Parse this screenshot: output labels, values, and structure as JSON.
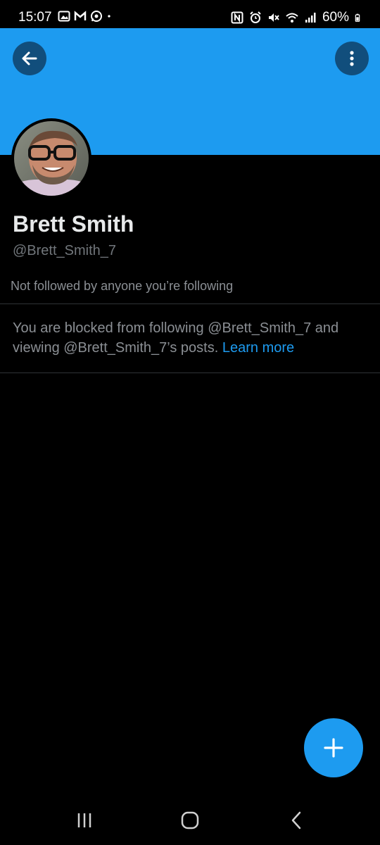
{
  "status_bar": {
    "time": "15:07",
    "battery": "60%",
    "left_icons": [
      "image-icon",
      "gmail-icon",
      "whatsapp-icon",
      "dot-icon"
    ],
    "right_icons": [
      "nfc-icon",
      "alarm-icon",
      "mute-icon",
      "wifi-icon",
      "signal-icon",
      "battery-icon"
    ]
  },
  "header": {
    "back_icon": "arrow-left-icon",
    "more_icon": "more-vertical-icon",
    "banner_color": "#1d9bf0"
  },
  "profile": {
    "name": "Brett Smith",
    "handle": "@Brett_Smith_7",
    "follow_note": "Not followed by anyone you’re following"
  },
  "blocked_notice": {
    "text": "You are blocked from following @Brett_Smith_7 and viewing @Brett_Smith_7’s posts.",
    "link": "Learn more"
  },
  "fab": {
    "icon": "plus-icon",
    "color": "#1d9bf0"
  },
  "nav_bar": {
    "recents_icon": "recents-icon",
    "home_icon": "home-icon",
    "back_icon": "nav-back-icon"
  }
}
